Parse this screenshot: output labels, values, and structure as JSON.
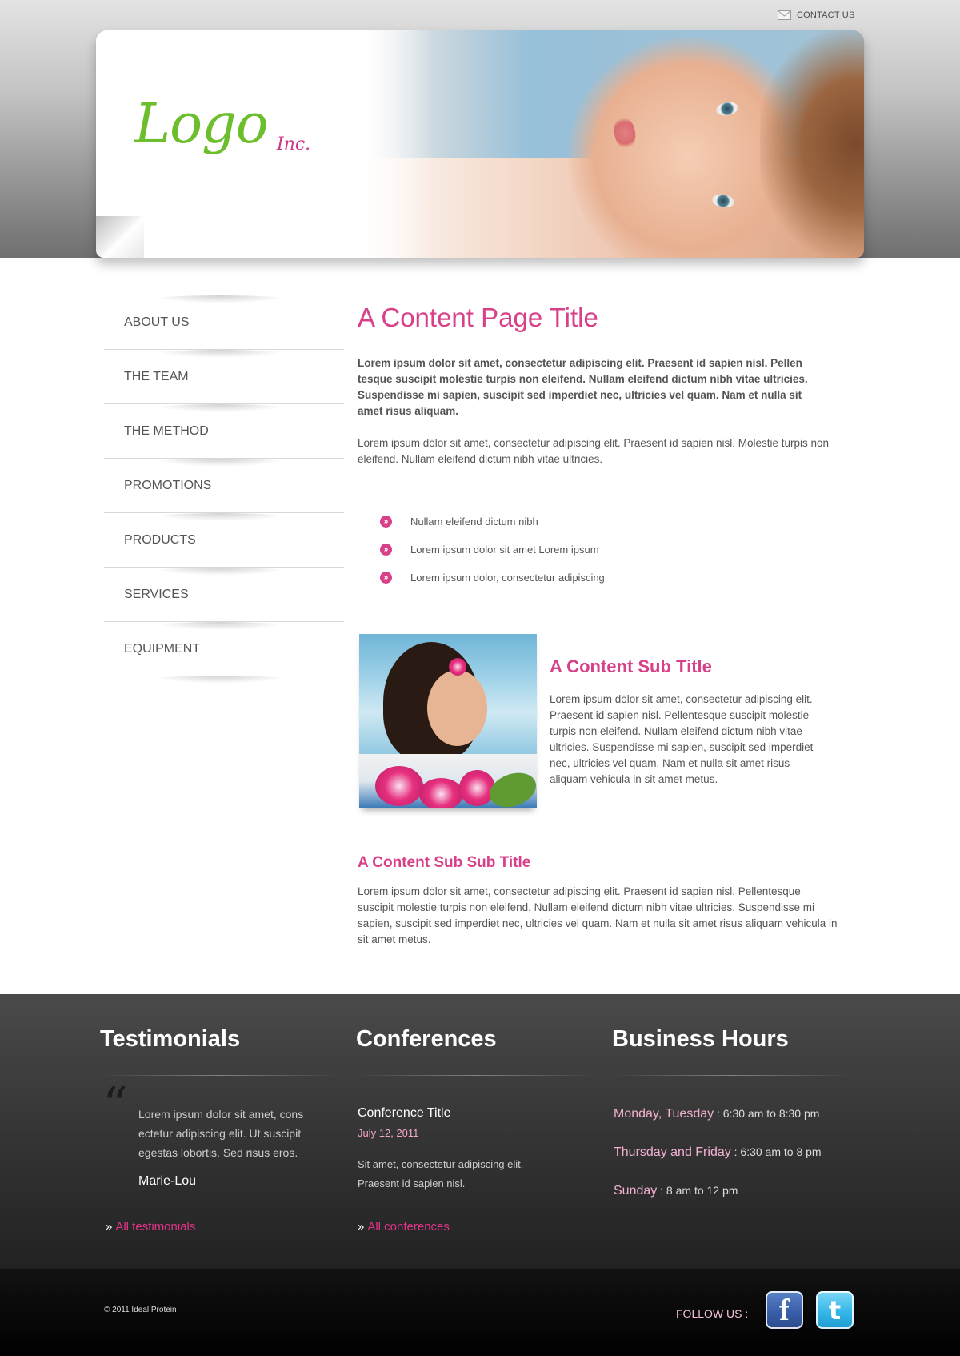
{
  "header": {
    "contact_label": "CONTACT US",
    "logo_text": "Logo",
    "logo_suffix": "Inc."
  },
  "nav": {
    "items": [
      {
        "label": "ABOUT US"
      },
      {
        "label": "THE TEAM"
      },
      {
        "label": "THE METHOD"
      },
      {
        "label": "PROMOTIONS"
      },
      {
        "label": "PRODUCTS"
      },
      {
        "label": "SERVICES"
      },
      {
        "label": "EQUIPMENT"
      }
    ]
  },
  "main": {
    "title": "A Content Page Title",
    "lead": "Lorem ipsum dolor sit amet, consectetur adipiscing elit. Praesent id sapien nisl. Pellen tesque suscipit molestie turpis non eleifend. Nullam eleifend dictum nibh vitae ultricies. Suspendisse mi sapien, suscipit sed imperdiet nec, ultricies vel quam. Nam et nulla sit amet risus aliquam.",
    "paragraph": "Lorem ipsum dolor sit amet, consectetur adipiscing elit. Praesent id sapien nisl. Molestie turpis non eleifend. Nullam eleifend dictum nibh vitae ultricies.",
    "bullet_glyph": "»",
    "bullets": [
      "Nullam eleifend dictum nibh",
      "Lorem ipsum dolor sit amet Lorem ipsum",
      "Lorem ipsum dolor, consectetur adipiscing"
    ],
    "sub_title": "A Content Sub Title",
    "sub_paragraph": "Lorem ipsum dolor sit amet, consectetur adipiscing elit. Praesent id sapien nisl. Pellentesque suscipit molestie turpis non eleifend. Nullam eleifend dictum nibh vitae ultricies. Suspendisse mi sapien, suscipit sed imperdiet nec, ultricies vel quam. Nam et nulla sit amet risus aliquam vehicula in sit amet metus.",
    "subsub_title": "A Content Sub Sub Title",
    "subsub_paragraph": "Lorem ipsum dolor sit amet, consectetur adipiscing elit. Praesent id sapien nisl. Pellentesque suscipit molestie turpis non eleifend. Nullam eleifend dictum nibh vitae ultricies. Suspendisse mi sapien, suscipit sed imperdiet nec, ultricies vel quam. Nam et nulla sit amet risus aliquam vehicula in sit amet metus."
  },
  "footer": {
    "testimonials": {
      "heading": "Testimonials",
      "quote_mark": "“",
      "text": "Lorem ipsum dolor sit amet, cons ectetur adipiscing elit. Ut suscipit egestas lobortis. Sed risus eros.",
      "author": "Marie-Lou",
      "link": "All testimonials"
    },
    "conferences": {
      "heading": "Conferences",
      "title": "Conference Title",
      "date": "July 12, 2011",
      "text": "Sit amet, consectetur adipiscing elit. Praesent id sapien nisl.",
      "link": "All conferences"
    },
    "hours": {
      "heading": "Business Hours",
      "rows": [
        {
          "day": "Monday, Tuesday",
          "time": " : 6:30 am to 8:30 pm"
        },
        {
          "day": "Thursday and Friday",
          "time": " : 6:30 am to 8 pm"
        },
        {
          "day": "Sunday",
          "time": " : 8 am to 12 pm"
        }
      ]
    },
    "link_prefix": "»"
  },
  "bottom": {
    "copyright": "© 2011 Ideal Protein",
    "follow_label": "FOLLOW US :",
    "facebook_glyph": "f",
    "twitter_glyph": "t"
  },
  "colors": {
    "accent_pink": "#d8408a",
    "logo_green": "#6dbe2c",
    "footer_dark": "#333333"
  },
  "icons": [
    "mail-icon",
    "bullet-arrow-icon",
    "quote-icon",
    "facebook-icon",
    "twitter-icon"
  ]
}
